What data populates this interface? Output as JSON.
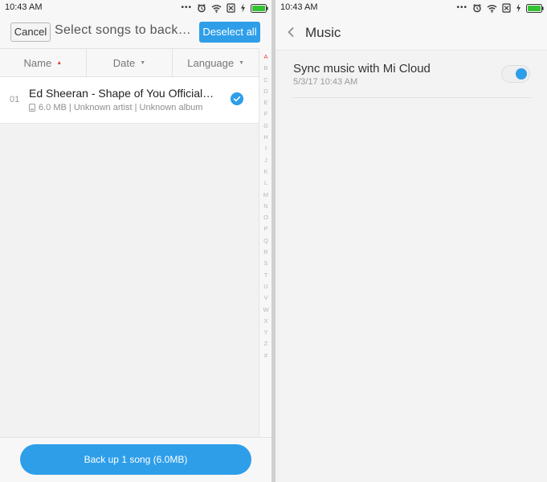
{
  "left": {
    "status_time": "10:43 AM",
    "cancel_label": "Cancel",
    "title": "Select songs to back…",
    "deselect_label": "Deselect all",
    "sort": [
      {
        "label": "Name",
        "arrow": "▲"
      },
      {
        "label": "Date",
        "arrow": "▼"
      },
      {
        "label": "Language",
        "arrow": "▼"
      }
    ],
    "alphabet": [
      "A",
      "B",
      "C",
      "D",
      "E",
      "F",
      "G",
      "H",
      "I",
      "J",
      "K",
      "L",
      "M",
      "N",
      "O",
      "P",
      "Q",
      "R",
      "S",
      "T",
      "U",
      "V",
      "W",
      "X",
      "Y",
      "Z",
      "#"
    ],
    "song": {
      "index": "01",
      "title": "Ed Sheeran - Shape of You Official…",
      "meta": "6.0 MB | Unknown artist | Unknown album",
      "selected": true
    },
    "backup_label": "Back up 1 song (6.0MB)"
  },
  "right": {
    "status_time": "10:43 AM",
    "title": "Music",
    "setting": {
      "label": "Sync music with Mi Cloud",
      "sub": "5/3/17 10:43 AM",
      "enabled": true
    }
  },
  "colors": {
    "accent": "#2e9ee9",
    "sort_active": "#e0483a",
    "battery": "#36c234"
  }
}
